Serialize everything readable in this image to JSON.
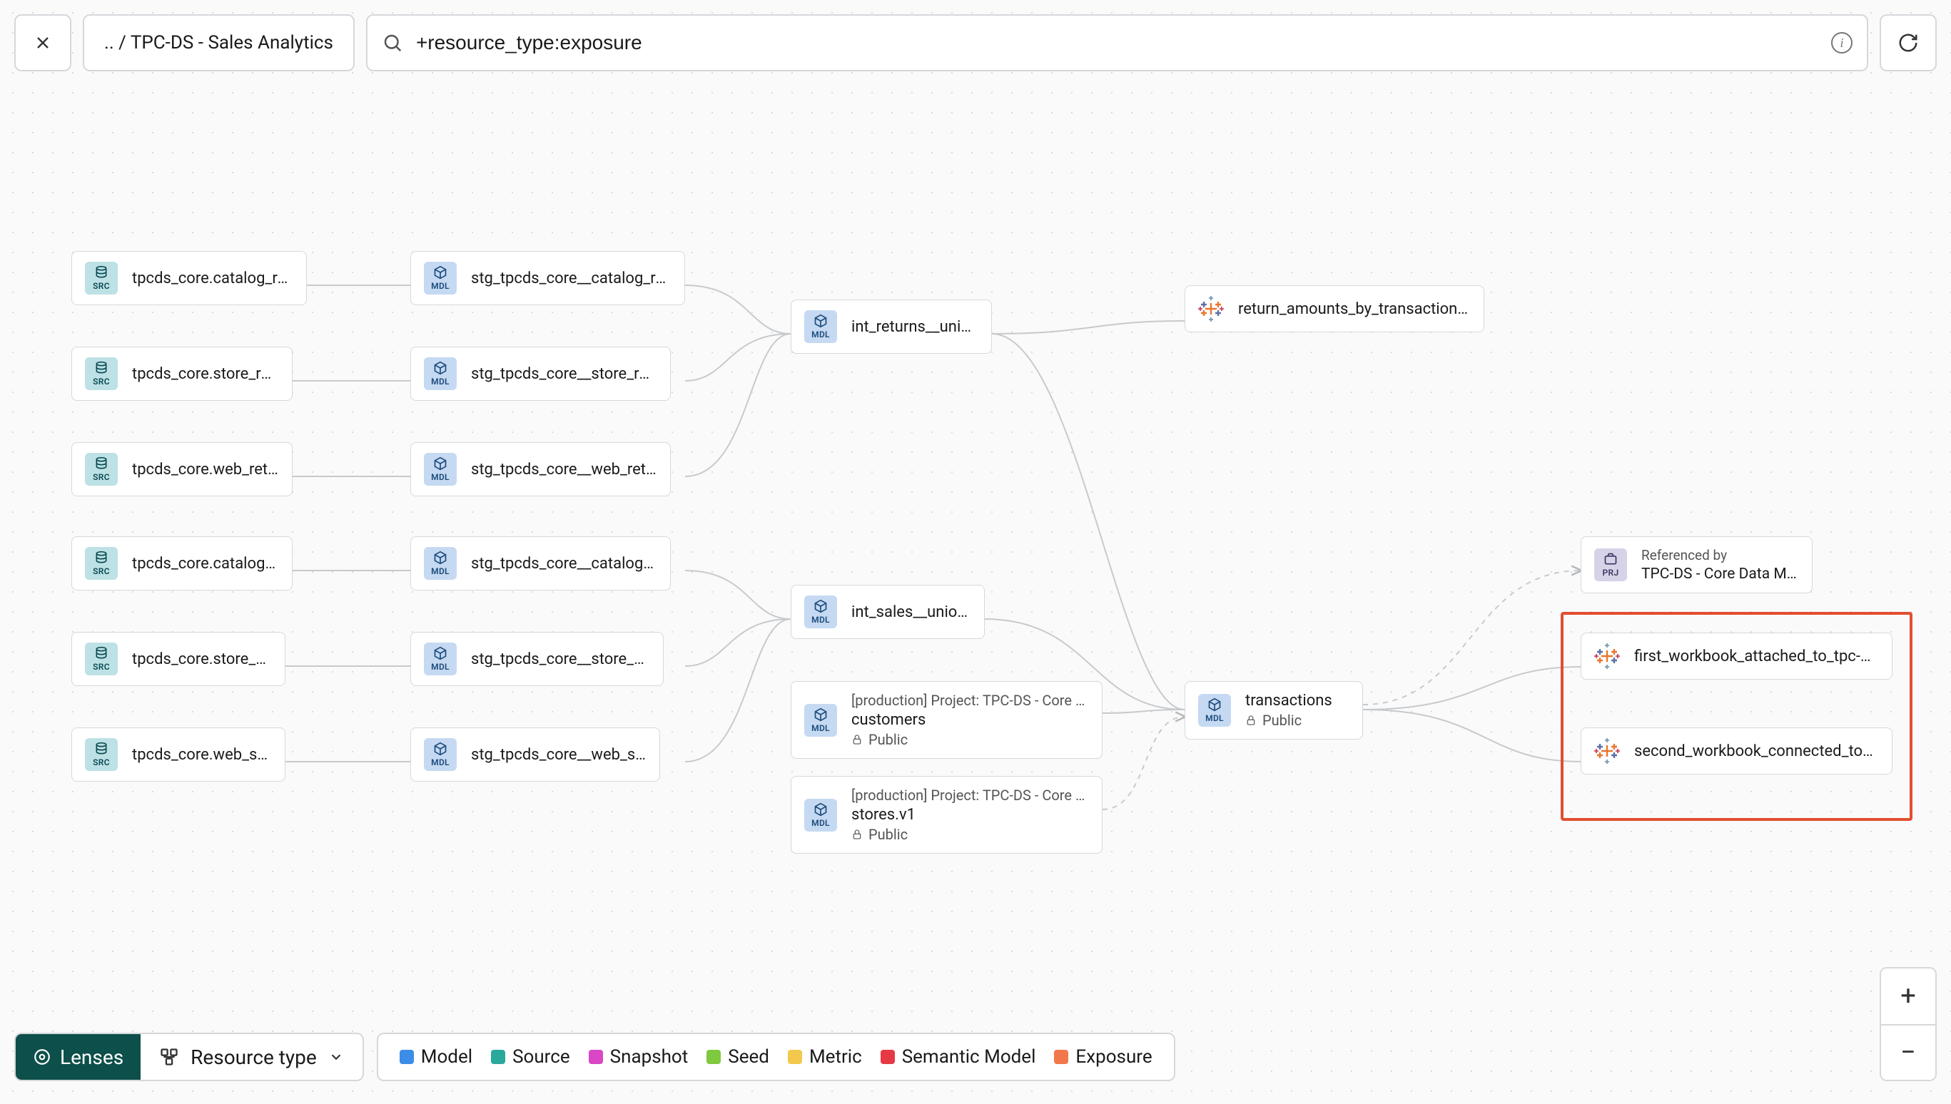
{
  "header": {
    "breadcrumb": ".. / TPC-DS - Sales Analytics",
    "search_value": "+resource_type:exposure"
  },
  "icons": {
    "close": "close-icon",
    "search": "search-icon",
    "info": "info-icon",
    "refresh": "refresh-icon",
    "lock": "lock-icon",
    "chevron_down": "chevron-down-icon",
    "lenses": "lenses-icon",
    "resource_type": "resource-type-icon"
  },
  "nodes": {
    "src": [
      {
        "id": "src1",
        "label": "tpcds_core.catalog_returns"
      },
      {
        "id": "src2",
        "label": "tpcds_core.store_returns"
      },
      {
        "id": "src3",
        "label": "tpcds_core.web_returns"
      },
      {
        "id": "src4",
        "label": "tpcds_core.catalog_sales"
      },
      {
        "id": "src5",
        "label": "tpcds_core.store_sales"
      },
      {
        "id": "src6",
        "label": "tpcds_core.web_sales"
      }
    ],
    "stg": [
      {
        "id": "stg1",
        "label": "stg_tpcds_core__catalog_returns"
      },
      {
        "id": "stg2",
        "label": "stg_tpcds_core__store_returns"
      },
      {
        "id": "stg3",
        "label": "stg_tpcds_core__web_returns"
      },
      {
        "id": "stg4",
        "label": "stg_tpcds_core__catalog_sales"
      },
      {
        "id": "stg5",
        "label": "stg_tpcds_core__store_sales"
      },
      {
        "id": "stg6",
        "label": "stg_tpcds_core__web_sales"
      }
    ],
    "int_returns": {
      "label": "int_returns__unioned"
    },
    "int_sales": {
      "label": "int_sales__unioned"
    },
    "customers": {
      "super": "[production] Project: TPC-DS - Core Data Mo…",
      "label": "customers",
      "sub": "Public"
    },
    "stores": {
      "super": "[production] Project: TPC-DS - Core Data Mo…",
      "label": "stores.v1",
      "sub": "Public"
    },
    "transactions": {
      "label": "transactions",
      "sub": "Public"
    },
    "return_amounts": {
      "label": "return_amounts_by_transaction_type"
    },
    "ref_prj": {
      "super": "Referenced by",
      "label": "TPC-DS - Core Data Models"
    },
    "exp1": {
      "label": "first_workbook_attached_to_tpc-ds_-_…"
    },
    "exp2": {
      "label": "second_workbook_connected_to_live…"
    }
  },
  "badge_labels": {
    "src": "SRC",
    "mdl": "MDL",
    "prj": "PRJ"
  },
  "bottom": {
    "lenses": "Lenses",
    "resource_type": "Resource type",
    "legend": [
      {
        "label": "Model",
        "color": "#3b8de8"
      },
      {
        "label": "Source",
        "color": "#2aa89b"
      },
      {
        "label": "Snapshot",
        "color": "#d946c6"
      },
      {
        "label": "Seed",
        "color": "#7fc93f"
      },
      {
        "label": "Metric",
        "color": "#f2c94c"
      },
      {
        "label": "Semantic Model",
        "color": "#e63946"
      },
      {
        "label": "Exposure",
        "color": "#f2784b"
      }
    ]
  },
  "zoom": {
    "in": "+",
    "out": "−"
  }
}
